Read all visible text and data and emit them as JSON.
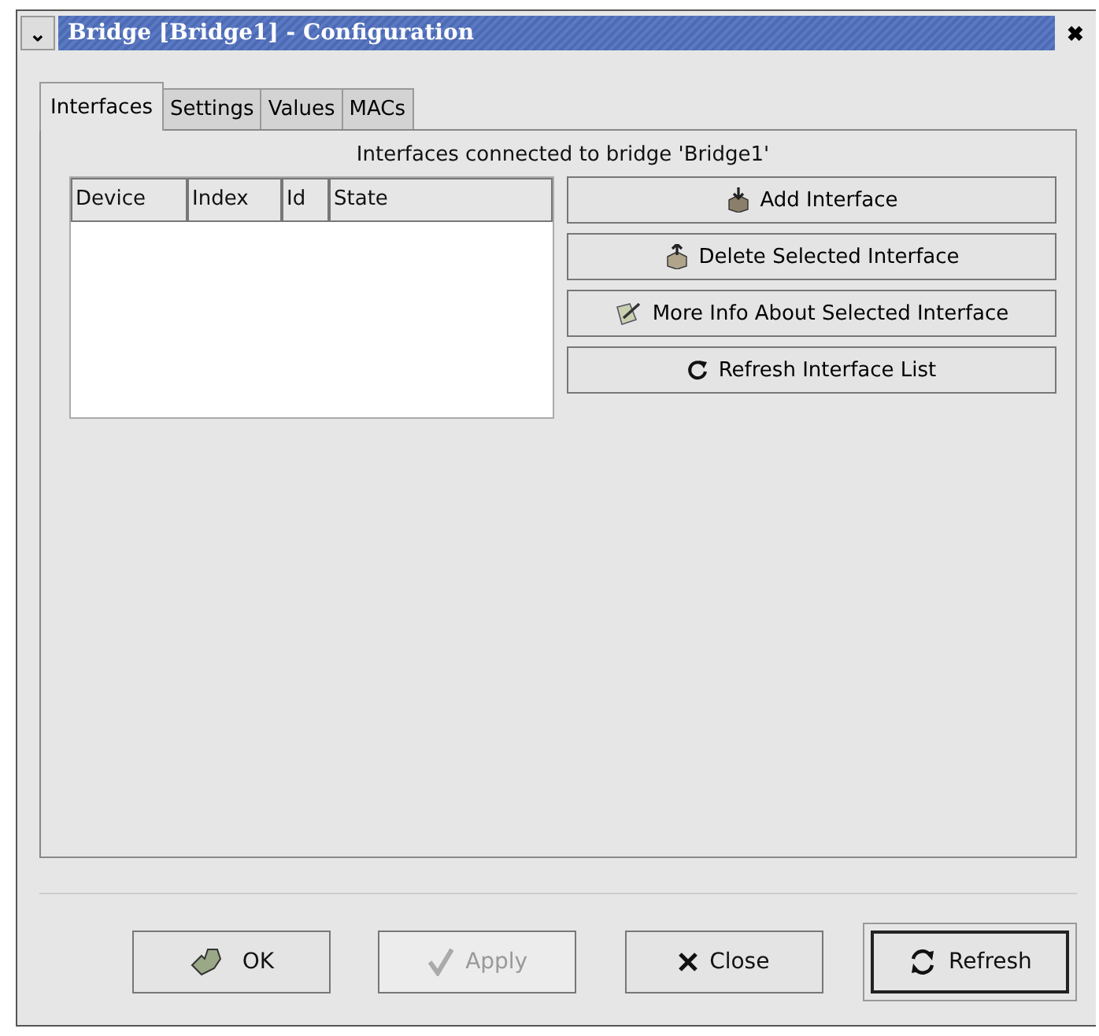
{
  "window": {
    "title": "Bridge [Bridge1] - Configuration",
    "menu_glyph": "⌄",
    "close_glyph": "✖"
  },
  "tabs": [
    {
      "label": "Interfaces",
      "selected": true
    },
    {
      "label": "Settings",
      "selected": false
    },
    {
      "label": "Values",
      "selected": false
    },
    {
      "label": "MACs",
      "selected": false
    }
  ],
  "heading": "Interfaces connected to bridge 'Bridge1'",
  "table": {
    "columns": [
      "Device",
      "Index",
      "Id",
      "State"
    ]
  },
  "side_buttons": [
    {
      "label": "Add Interface",
      "kind": "add"
    },
    {
      "label": "Delete Selected Interface",
      "kind": "delete"
    },
    {
      "label": "More Info About Selected Interface",
      "kind": "info"
    },
    {
      "label": "Refresh Interface List",
      "kind": "refresh"
    }
  ],
  "buttons": [
    {
      "label": "OK",
      "kind": "ok",
      "disabled": false,
      "default": false
    },
    {
      "label": "Apply",
      "kind": "apply",
      "disabled": true,
      "default": false
    },
    {
      "label": "Close",
      "kind": "close",
      "disabled": false,
      "default": false
    },
    {
      "label": "Refresh",
      "kind": "refresh",
      "disabled": false,
      "default": true
    }
  ]
}
